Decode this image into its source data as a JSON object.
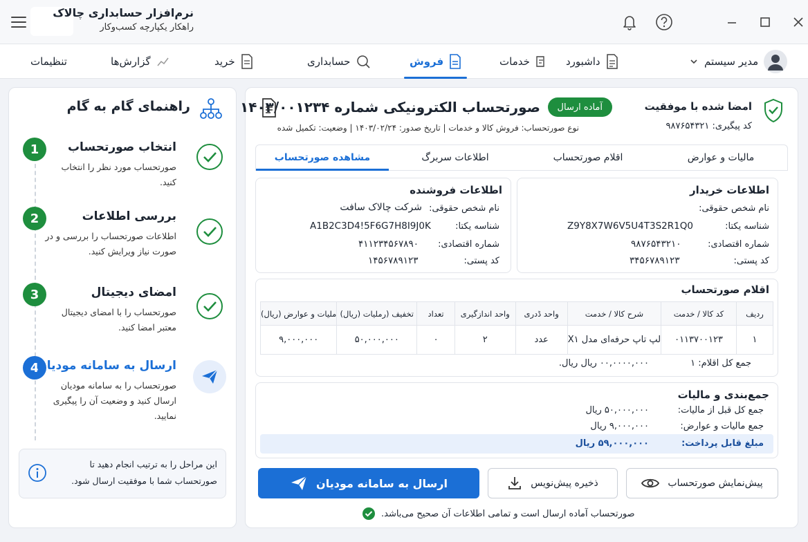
{
  "window": {
    "app_name": "نرم‌افزار حسابداری چالاک",
    "app_subtitle": "راهکار یکپارچه کسب‌وکار",
    "icons": [
      "menu-icon",
      "bell-icon",
      "help-icon",
      "minimize-icon",
      "maximize-icon",
      "close-icon"
    ]
  },
  "nav": {
    "user_name": "مدیر سیستم",
    "items": [
      {
        "label": "داشبورد",
        "icon": "dashboard-icon"
      },
      {
        "label": "خدمات",
        "icon": "services-icon"
      },
      {
        "label": "فروش",
        "icon": "sales-icon",
        "active": true
      },
      {
        "label": "حسابداری",
        "icon": "accounting-icon"
      },
      {
        "label": "خرید",
        "icon": "purchase-icon"
      },
      {
        "label": "گزارش‌ها",
        "icon": "reports-icon"
      },
      {
        "label": "تنظیمات",
        "icon": "settings-icon"
      }
    ]
  },
  "guide": {
    "title": "راهنمای گام به گام",
    "steps": [
      {
        "num": "1",
        "title": "انتخاب صورتحساب",
        "desc": "صورتحساب مورد نظر را انتخاب کنید.",
        "done": true
      },
      {
        "num": "2",
        "title": "بررسی اطلاعات",
        "desc": "اطلاعات صورتحساب را بررسی و در صورت نیاز ویرایش کنید.",
        "done": true
      },
      {
        "num": "3",
        "title": "امضای دیجیتال",
        "desc": "صورتحساب را با امضای دیجیتال معتبر امضا کنید.",
        "done": true
      },
      {
        "num": "4",
        "title": "ارسال به سامانه مودیان",
        "desc": "صورتحساب را به سامانه مودیان ارسال کنید و وضعیت آن را پیگیری نمایید.",
        "done": false
      }
    ],
    "note": "این مراحل را به ترتیب انجام دهید تا صورتحساب شما با موفقیت ارسال شود."
  },
  "invoice": {
    "signed_label": "امضا شده با موفقیت",
    "tracking_code": "کد پیگیری: ۹۸۷۶۵۴۳۲۱",
    "title": "صورتحساب الکترونیکی شماره ۱۴۰۳/۰۰۱۲۳۴",
    "status": "آماده ارسال",
    "meta": "نوع صورتحساب: فروش کالا و خدمات  |  تاریخ صدور: ۱۴۰۳/۰۲/۲۴  |  وضعیت: تکمیل شده",
    "tabs": [
      "مالیات و عوارض",
      "اقلام صورتحساب",
      "اطلاعات سربرگ",
      "مشاهده صورتحساب"
    ],
    "active_tab": 3,
    "buyer": {
      "title": "اطلاعات خریدار",
      "name_label": "نام شخص حقوقی:",
      "name_value": "",
      "id_label": "شناسه یکتا:",
      "id_value": "Z9Y8X7W6V5U4T3S2R1Q0",
      "econ_label": "شماره اقتصادی:",
      "econ_value": "۹۸۷۶۵۴۳۲۱۰",
      "postal_label": "کد پستی:",
      "postal_value": "۳۴۵۶۷۸۹۱۲۳"
    },
    "seller": {
      "title": "اطلاعات فروشنده",
      "name_label": "نام شخص حقوقی:",
      "name_value": "شرکت چالاک سافت",
      "id_label": "شناسه یکتا:",
      "id_value": "A1B2C3D4!5F6G7H8I9J0K",
      "econ_label": "شماره اقتصادی:",
      "econ_value": "۴۱۱۲۳۴۵۶۷۸۹۰",
      "postal_label": "کد پستی:",
      "postal_value": "۱۴۵۶۷۸۹۱۲۳"
    },
    "items": {
      "title": "اقلام صورتحساب",
      "headers": [
        "ردیف",
        "کد کالا / خدمت",
        "شرح کالا / خدمت",
        "واحد ڈدری",
        "واحد اندازگیری",
        "تعداد",
        "تخفیف (رملیات (ریال)",
        "ملیات و عوارض (ریال)"
      ],
      "rows": [
        [
          "۱",
          "۰۱۱۳۷۰۰۱۲۳",
          "لپ تاپ حرفه‌ای مدل X۱",
          "عدد",
          "۲",
          "۰",
          "۵۰,۰۰۰,۰۰۰",
          "۹,۰۰۰,۰۰۰"
        ]
      ],
      "total_label": "جمع کل اقلام: ۱",
      "total_value": "۰۰,۰۰۰۰,۰۰۰ ریال ریال."
    },
    "summary": {
      "title": "جمع‌بندی و مالیات",
      "before_tax_label": "جمع کل قبل از مالیات:",
      "before_tax_value": "۵۰,۰۰۰,۰۰۰ ریال",
      "tax_label": "جمع مالیات و عوارض:",
      "tax_value": "۹,۰۰۰,۰۰۰ ریال",
      "payable_label": "مبلغ قابل پرداخت:",
      "payable_value": "۵۹,۰۰۰,۰۰۰ ریال"
    },
    "buttons": {
      "send": "ارسال به سامانه مودیان",
      "draft": "ذخیره پیش‌نویس",
      "preview": "پیش‌نمایش صورتحساب"
    },
    "ready_note": "صورتحساب آماده ارسال است و تمامی اطلاعات آن صحیح می‌باشد."
  },
  "colors": {
    "accent": "#1b6fd6",
    "success": "#1e8e3e",
    "panel_bg": "#ffffff",
    "page_bg": "#f1f3f7"
  }
}
